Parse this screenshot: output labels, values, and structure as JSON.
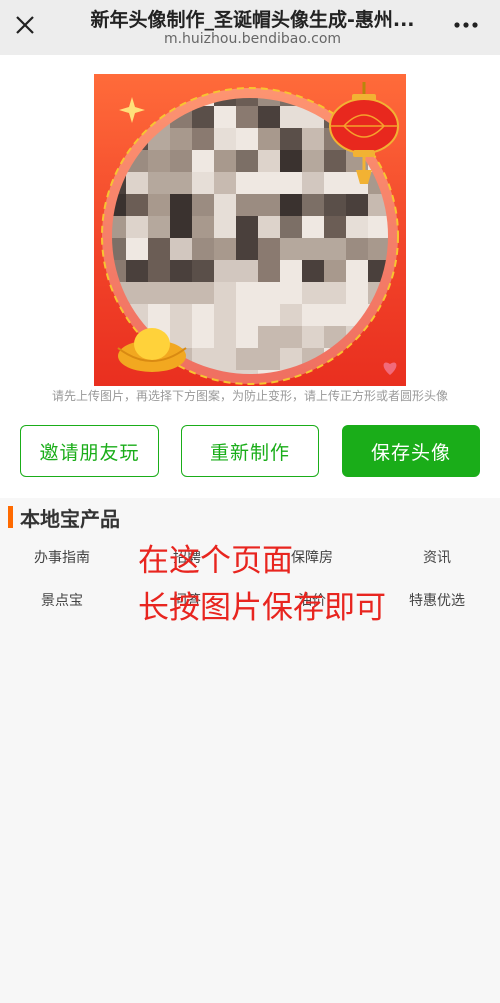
{
  "browser": {
    "title": "新年头像制作_圣诞帽头像生成-惠州...",
    "url": "m.huizhou.bendibao.com"
  },
  "hint": "请先上传图片，再选择下方图案，为防止变形，请上传正方形或者圆形头像",
  "actions": {
    "invite": "邀请朋友玩",
    "remake": "重新制作",
    "save": "保存头像"
  },
  "section": {
    "title": "本地宝产品",
    "products": [
      "办事指南",
      "招聘",
      "保障房",
      "资讯",
      "景点宝",
      "问答",
      "油价",
      "特惠优选"
    ]
  },
  "overlay": {
    "line1": "在这个页面",
    "line2": "长按图片保存即可"
  },
  "colors": {
    "primary_green": "#1aad19",
    "frame_red": "#f2452a",
    "annotation_red": "#e8251f",
    "section_accent": "#ff6a00"
  }
}
